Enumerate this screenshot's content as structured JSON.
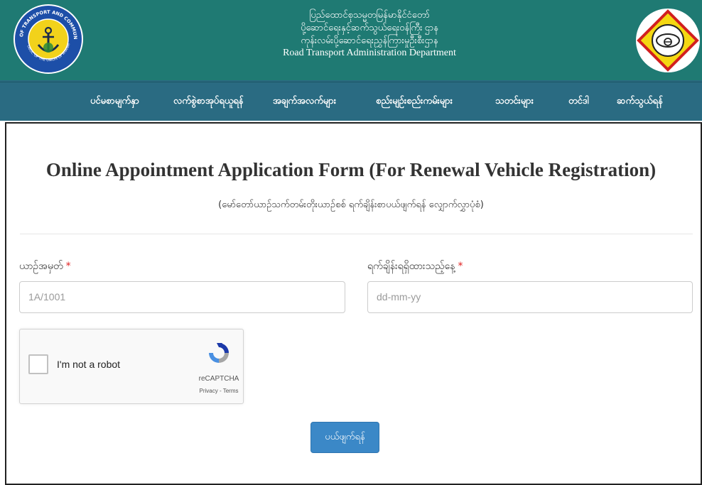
{
  "header": {
    "title_lines": [
      "ပြည်ထောင်စုသမ္မတမြန်မာနိုင်ငံတော်",
      "ပို့ဆောင်ရေးနှင့်ဆက်သွယ်ရေးဝန်ကြီး ဌာန",
      "ကုန်းလမ်းပို့ဆောင်ရေးညွှန်ကြားမှုဦးစီးဌာန"
    ],
    "title_en": "Road Transport Administration Department",
    "left_logo_text": "MINISTRY OF TRANSPORT AND COMMUNICATIONS",
    "left_logo_bottom": "REPUBLIC OF THE UNION OF MYANMAR"
  },
  "nav": {
    "items": [
      "ပင်မစာမျက်နှာ",
      "လက်စွဲစာအုပ်ရယူရန်",
      "အချက်အလက်များ",
      "စည်းမျဉ်းစည်းကမ်းများ",
      "သတင်းများ",
      "တင်ဒါ",
      "ဆက်သွယ်ရန်"
    ]
  },
  "form": {
    "title": "Online Appointment Application Form (For Renewal Vehicle Registration)",
    "subtitle": "(မော်တော်ယာဉ်သက်တမ်းတိုးယာဉ်စစ် ရက်ချိန်းစာပယ်ဖျက်ရန် လျှောက်လွှာပုံစံ)",
    "vehicle_no_label": "ယာဉ်အမှတ်",
    "vehicle_no_placeholder": "1A/1001",
    "appointment_date_label": "ရက်ချိန်းရရှိထားသည့်နေ့",
    "appointment_date_placeholder": "dd-mm-yy",
    "required_mark": "*",
    "submit_label": "ပယ်ဖျက်ရန်"
  },
  "recaptcha": {
    "label": "I'm not a robot",
    "brand": "reCAPTCHA",
    "links": "Privacy - Terms"
  },
  "colors": {
    "header_bg": "#1f7a73",
    "nav_bg": "#2a6b82",
    "required": "#e02020",
    "submit_bg": "#3b88c7"
  }
}
